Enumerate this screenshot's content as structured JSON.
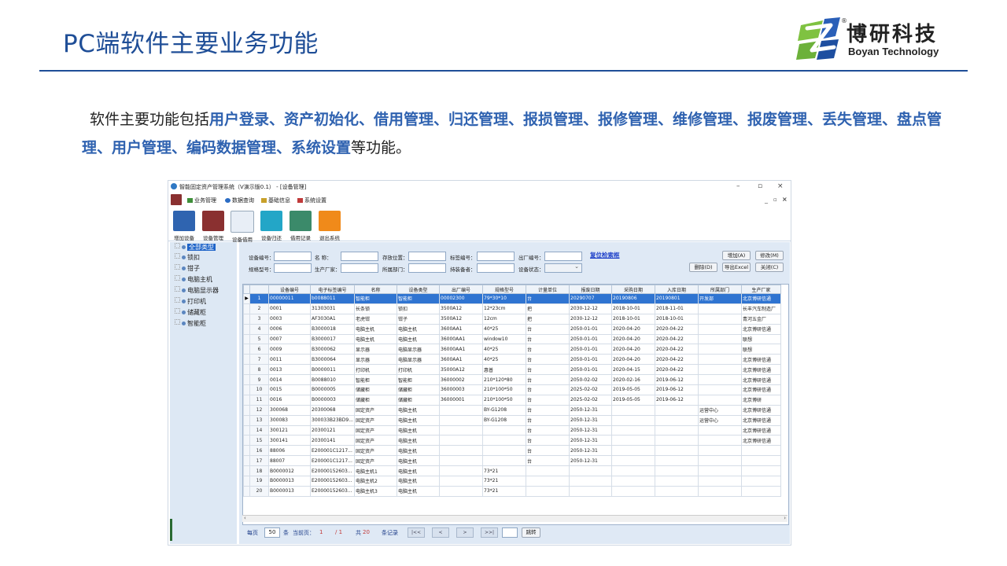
{
  "slide": {
    "title": "PC端软件主要业务功能",
    "logo_cn": "博研科技",
    "logo_en": "Boyan Technology",
    "logo_reg": "®",
    "intro": {
      "prefix": "软件主要功能包括",
      "highlight": "用户登录、资产初始化、借用管理、归还管理、报损管理、报修管理、维修管理、报废管理、丢失管理、盘点管理、用户管理、编码数据管理、系统设置",
      "suffix": "等功能。"
    }
  },
  "app": {
    "title": "智能固定资产管理系统（V演示版0.1） - [设备管理]",
    "window_controls": [
      "–",
      "▫",
      "×"
    ],
    "mdi_controls": [
      "_",
      "▫",
      "×"
    ],
    "menu": [
      {
        "label": "业务管理",
        "icon": "tree-icon",
        "color": "#3f8f3a"
      },
      {
        "label": "数据查询",
        "icon": "search-icon",
        "color": "#2b6cc4"
      },
      {
        "label": "基础信息",
        "icon": "chart-icon",
        "color": "#c8a02a"
      },
      {
        "label": "系统设置",
        "icon": "gear-icon",
        "color": "#c03a3a"
      }
    ],
    "toolbar": [
      {
        "label": "增加设备",
        "icon": "add-device-icon",
        "color": "#2f64b0"
      },
      {
        "label": "设备管理",
        "icon": "device-manage-icon",
        "color": "#8a3030"
      },
      {
        "label": "设备借用",
        "icon": "borrow-icon",
        "color": "#3a7abf"
      },
      {
        "label": "设备归还",
        "icon": "return-icon",
        "color": "#23a6c7"
      },
      {
        "label": "借用记录",
        "icon": "record-icon",
        "color": "#3b8a6a"
      },
      {
        "label": "退出系统",
        "icon": "power-icon",
        "color": "#f08a1a"
      }
    ],
    "tree": [
      {
        "label": "全部类型",
        "selected": true
      },
      {
        "label": "锁扣"
      },
      {
        "label": "钳子"
      },
      {
        "label": "电脑主机"
      },
      {
        "label": "电脑显示器"
      },
      {
        "label": "打印机"
      },
      {
        "label": "储藏柜"
      },
      {
        "label": "智能柜"
      }
    ],
    "filters": {
      "row1": [
        "设备编号：",
        "名    称：",
        "存放位置：",
        "标签编号：",
        "出厂编号："
      ],
      "row2": [
        "规格型号：",
        "生产厂家：",
        "所属部门：",
        "持装备者：",
        "设备状态："
      ],
      "reset": "复位检索框",
      "buttons_row1": [
        "增加(A)",
        "修改(M)"
      ],
      "buttons_row2": [
        "删除(D)",
        "导出Excel",
        "关闭(C)"
      ]
    },
    "columns": [
      "",
      "",
      "设备编号",
      "电子标签编号",
      "名称",
      "设备类型",
      "出厂编号",
      "规格型号",
      "计量单位",
      "报废日期",
      "采购日期",
      "入库日期",
      "所属部门",
      "生产厂家"
    ],
    "rows": [
      [
        "▶",
        "1",
        "00000011",
        "b0088011",
        "智能柜",
        "智能柜",
        "00002300",
        "79*30*10",
        "台",
        "20290707",
        "20190806",
        "20190801",
        "开发部",
        "北京博研信通"
      ],
      [
        "",
        "2",
        "0001",
        "31303031",
        "长条锁",
        "锁扣",
        "3500A12",
        "12*23cm",
        "把",
        "2030-12-12",
        "2018-10-01",
        "2018-11-01",
        "",
        "长丰汽车制造厂"
      ],
      [
        "",
        "3",
        "0003",
        "AF3030A1",
        "老虎钳",
        "钳子",
        "3500A12",
        "12cm",
        "把",
        "2030-12-12",
        "2018-10-01",
        "2018-10-01",
        "",
        "青河五金厂"
      ],
      [
        "",
        "4",
        "0006",
        "B3000018",
        "电脑主机",
        "电脑主机",
        "3600AA1",
        "40*25",
        "台",
        "2050-01-01",
        "2020-04-20",
        "2020-04-22",
        "",
        "北京博研信通"
      ],
      [
        "",
        "5",
        "0007",
        "B3000017",
        "电脑主机",
        "电脑主机",
        "36000AA1",
        "window10",
        "台",
        "2050-01-01",
        "2020-04-20",
        "2020-04-22",
        "",
        "联想"
      ],
      [
        "",
        "6",
        "0009",
        "B3000062",
        "显示器",
        "电脑显示器",
        "36000AA1",
        "40*25",
        "台",
        "2050-01-01",
        "2020-04-20",
        "2020-04-22",
        "",
        "联想"
      ],
      [
        "",
        "7",
        "0011",
        "B3000064",
        "显示器",
        "电脑显示器",
        "3600AA1",
        "40*25",
        "台",
        "2050-01-01",
        "2020-04-20",
        "2020-04-22",
        "",
        "北京博研信通"
      ],
      [
        "",
        "8",
        "0013",
        "B0000011",
        "打印机",
        "打印机",
        "35000A12",
        "惠普",
        "台",
        "2050-01-01",
        "2020-04-15",
        "2020-04-22",
        "",
        "北京博研信通"
      ],
      [
        "",
        "9",
        "0014",
        "B0088010",
        "智能柜",
        "智能柜",
        "36000002",
        "210*120*80",
        "台",
        "2050-02-02",
        "2020-02-16",
        "2019-06-12",
        "",
        "北京博研信通"
      ],
      [
        "",
        "10",
        "0015",
        "B0000005",
        "储藏柜",
        "储藏柜",
        "36000003",
        "210*100*50",
        "台",
        "2025-02-02",
        "2019-05-05",
        "2019-06-12",
        "",
        "北京博研信通"
      ],
      [
        "",
        "11",
        "0016",
        "B0000003",
        "储藏柜",
        "储藏柜",
        "36000001",
        "210*100*50",
        "台",
        "2025-02-02",
        "2019-05-05",
        "2019-06-12",
        "",
        "北京博研"
      ],
      [
        "",
        "12",
        "300068",
        "20300068",
        "固定资产",
        "电脑主机",
        "",
        "BY-G1208",
        "台",
        "2050-12-31",
        "",
        "",
        "运营中心",
        "北京博研信通"
      ],
      [
        "",
        "13",
        "300083",
        "300033B23BD9...",
        "固定资产",
        "电脑主机",
        "",
        "BY-G1208",
        "台",
        "2050-12-31",
        "",
        "",
        "运营中心",
        "北京博研信通"
      ],
      [
        "",
        "14",
        "300121",
        "20300121",
        "固定资产",
        "电脑主机",
        "",
        "",
        "台",
        "2050-12-31",
        "",
        "",
        "",
        "北京博研信通"
      ],
      [
        "",
        "15",
        "300141",
        "20300141",
        "固定资产",
        "电脑主机",
        "",
        "",
        "台",
        "2050-12-31",
        "",
        "",
        "",
        "北京博研信通"
      ],
      [
        "",
        "16",
        "88006",
        "E200001C1217...",
        "固定资产",
        "电脑主机",
        "",
        "",
        "台",
        "2050-12-31",
        "",
        "",
        "",
        ""
      ],
      [
        "",
        "17",
        "88007",
        "E200001C1217...",
        "固定资产",
        "电脑主机",
        "",
        "",
        "台",
        "2050-12-31",
        "",
        "",
        "",
        ""
      ],
      [
        "",
        "18",
        "B0000012",
        "E20000152603...",
        "电脑主机1",
        "电脑主机",
        "",
        "73*21",
        "",
        "",
        "",
        "",
        "",
        ""
      ],
      [
        "",
        "19",
        "B0000013",
        "E20000152603...",
        "电脑主机2",
        "电脑主机",
        "",
        "73*21",
        "",
        "",
        "",
        "",
        "",
        ""
      ],
      [
        "",
        "20",
        "B0000013",
        "E20000152603...",
        "电脑主机3",
        "电脑主机",
        "",
        "73*21",
        "",
        "",
        "",
        "",
        "",
        ""
      ]
    ],
    "pager": {
      "per_page_label": "每页",
      "per_page_value": "50",
      "unit1": "条",
      "current_label": "当前页：",
      "current_value": "1",
      "total_pages": "/ 1",
      "total_label": "共",
      "total_value": "20",
      "records_label": "条记录",
      "first": "|<<",
      "prev": "<",
      "next": ">",
      "last": ">>|",
      "jump": "跳转"
    },
    "colors": {
      "accent": "#1f4e97",
      "highlight_text": "#2f62b0",
      "selected_row": "#2f74d1"
    }
  }
}
